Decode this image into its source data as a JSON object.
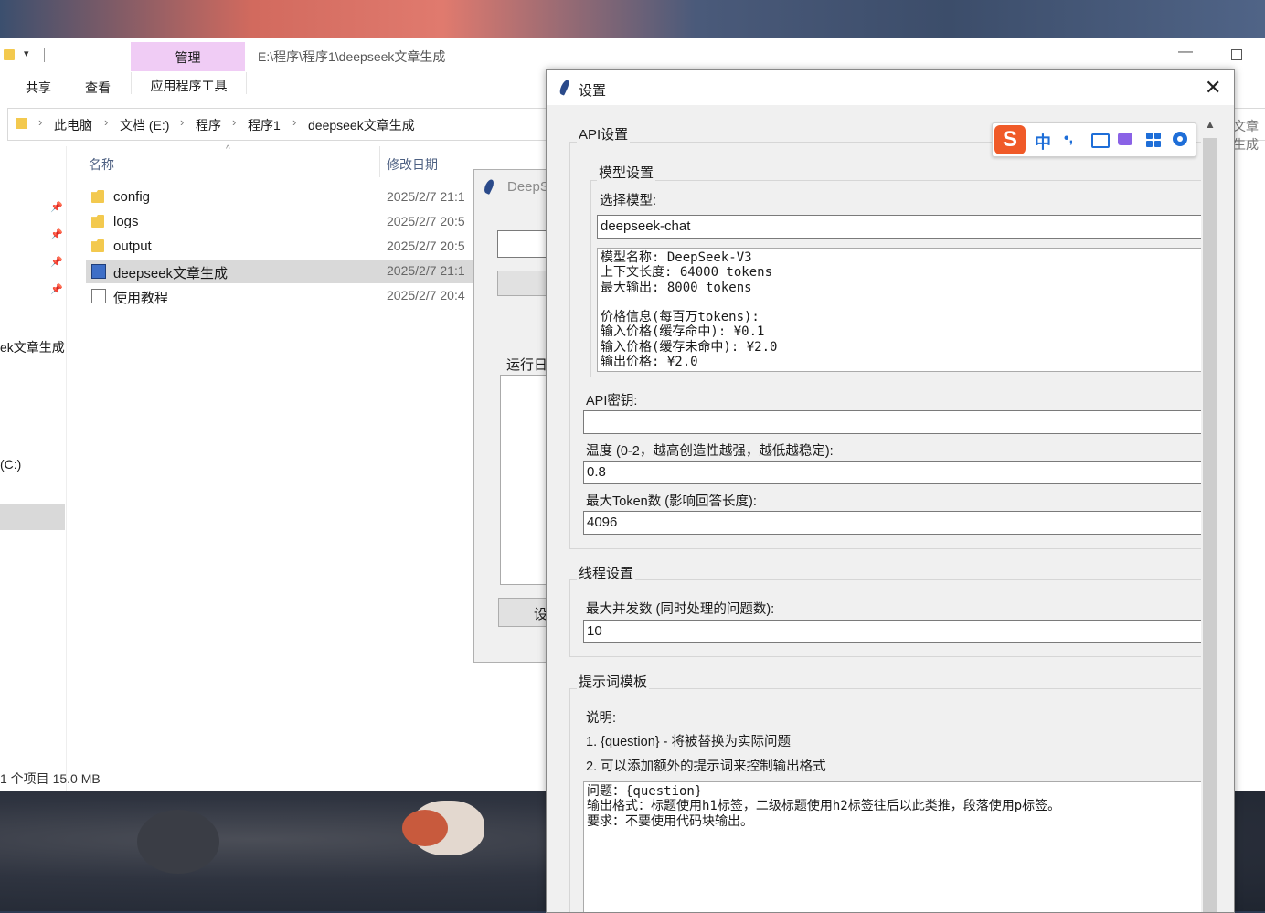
{
  "explorer": {
    "ribbon": {
      "manage": "管理",
      "app_tools": "应用程序工具",
      "share": "共享",
      "view": "查看"
    },
    "path_title": "E:\\程序\\程序1\\deepseek文章生成",
    "breadcrumbs": [
      "此电脑",
      "文档 (E:)",
      "程序",
      "程序1",
      "deepseek文章生成"
    ],
    "right_fragment": "文章生成",
    "columns": {
      "name": "名称",
      "date": "修改日期"
    },
    "nav": {
      "item1": "ek文章生成",
      "item2": "(C:)"
    },
    "files": [
      {
        "name": "config",
        "date": "2025/2/7 21:1",
        "kind": "folder"
      },
      {
        "name": "logs",
        "date": "2025/2/7 20:5",
        "kind": "folder"
      },
      {
        "name": "output",
        "date": "2025/2/7 20:5",
        "kind": "folder"
      },
      {
        "name": "deepseek文章生成",
        "date": "2025/2/7 21:1",
        "kind": "app"
      },
      {
        "name": "使用教程",
        "date": "2025/2/7 20:4",
        "kind": "doc"
      }
    ],
    "status": "1 个项目  15.0 MB"
  },
  "bg_dialog": {
    "title": "DeepS",
    "log_label": "运行日",
    "btn": "设"
  },
  "settings": {
    "title": "设置",
    "api_group": "API设置",
    "model_group": "模型设置",
    "select_model_label": "选择模型:",
    "model_value": "deepseek-chat",
    "model_info": "模型名称: DeepSeek-V3\n上下文长度: 64000 tokens\n最大输出: 8000 tokens\n\n价格信息(每百万tokens):\n输入价格(缓存命中): ¥0.1\n输入价格(缓存未命中): ¥2.0\n输出价格: ¥2.0",
    "api_key_label": "API密钥:",
    "api_key_value": "",
    "temp_label": "温度 (0-2，越高创造性越强，越低越稳定):",
    "temp_value": "0.8",
    "max_token_label": "最大Token数 (影响回答长度):",
    "max_token_value": "4096",
    "thread_group": "线程设置",
    "concurrency_label": "最大并发数 (同时处理的问题数):",
    "concurrency_value": "10",
    "prompt_group": "提示词模板",
    "note_title": "说明:",
    "note_1": "1. {question} - 将被替换为实际问题",
    "note_2": "2. 可以添加额外的提示词来控制输出格式",
    "template": "问题：{question}\n输出格式：标题使用h1标签，二级标题使用h2标签往后以此类推，段落使用p标签。\n要求：不要使用代码块输出。"
  },
  "ime": {
    "logo": "S",
    "mode": "中",
    "punct": "•,"
  }
}
